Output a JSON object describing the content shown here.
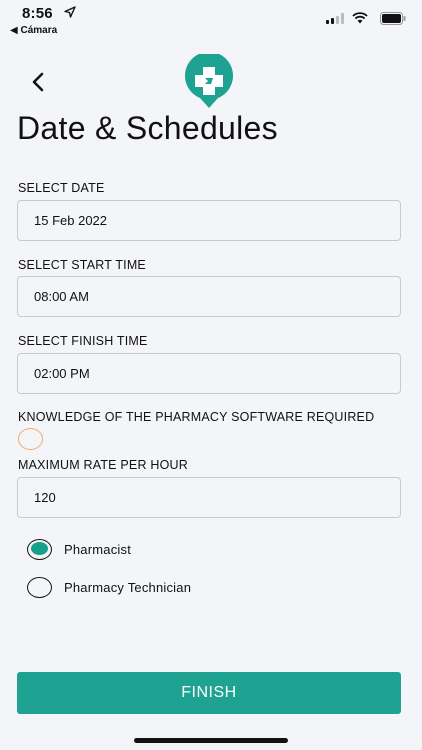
{
  "status_bar": {
    "time": "8:56",
    "back_app": "◀ Cámara"
  },
  "header": {
    "title": "Date & Schedules",
    "back_icon": "chevron-left-icon",
    "logo_icon": "pharmacy-map-pin-logo"
  },
  "form": {
    "date": {
      "label": "SELECT DATE",
      "value": "15 Feb 2022"
    },
    "start_time": {
      "label": "SELECT START TIME",
      "value": "08:00 AM"
    },
    "finish_time": {
      "label": "SELECT FINISH TIME",
      "value": "02:00 PM"
    },
    "software": {
      "label": "KNOWLEDGE OF THE PHARMACY SOFTWARE REQUIRED",
      "checked": false
    },
    "rate": {
      "label": "MAXIMUM RATE PER HOUR",
      "value": "120"
    },
    "role_options": [
      {
        "label": "Pharmacist",
        "selected": true
      },
      {
        "label": "Pharmacy Technician",
        "selected": false
      }
    ]
  },
  "actions": {
    "finish_label": "FINISH"
  },
  "colors": {
    "accent": "#1ea392",
    "radio_fill": "#16a08c",
    "checkbox_border": "#f0a974",
    "background": "#f4f5f8"
  }
}
